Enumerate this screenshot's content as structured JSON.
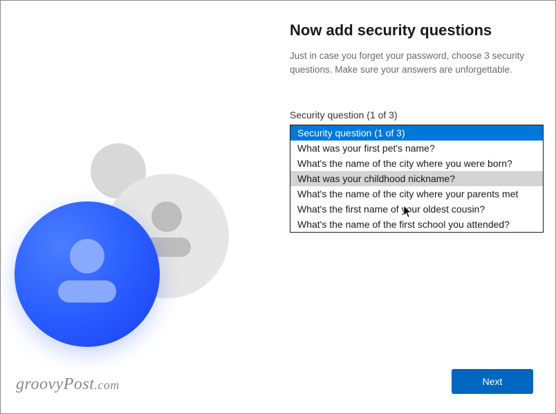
{
  "header": {
    "title": "Now add security questions",
    "subtitle": "Just in case you forget your password, choose 3 security questions. Make sure your answers are unforgettable."
  },
  "field": {
    "label": "Security question (1 of 3)",
    "options": [
      "Security question (1 of 3)",
      "What was your first pet's name?",
      "What's the name of the city where you were born?",
      "What was your childhood nickname?",
      "What's the name of the city where your parents met",
      "What's the first name of your oldest cousin?",
      "What's the name of the first school you attended?"
    ],
    "selected_index": 0,
    "hovered_index": 3
  },
  "buttons": {
    "next": "Next"
  },
  "watermark": {
    "brand": "groovyPost",
    "suffix": ".com"
  },
  "colors": {
    "accent": "#0067c0",
    "highlight": "#0078d7"
  }
}
